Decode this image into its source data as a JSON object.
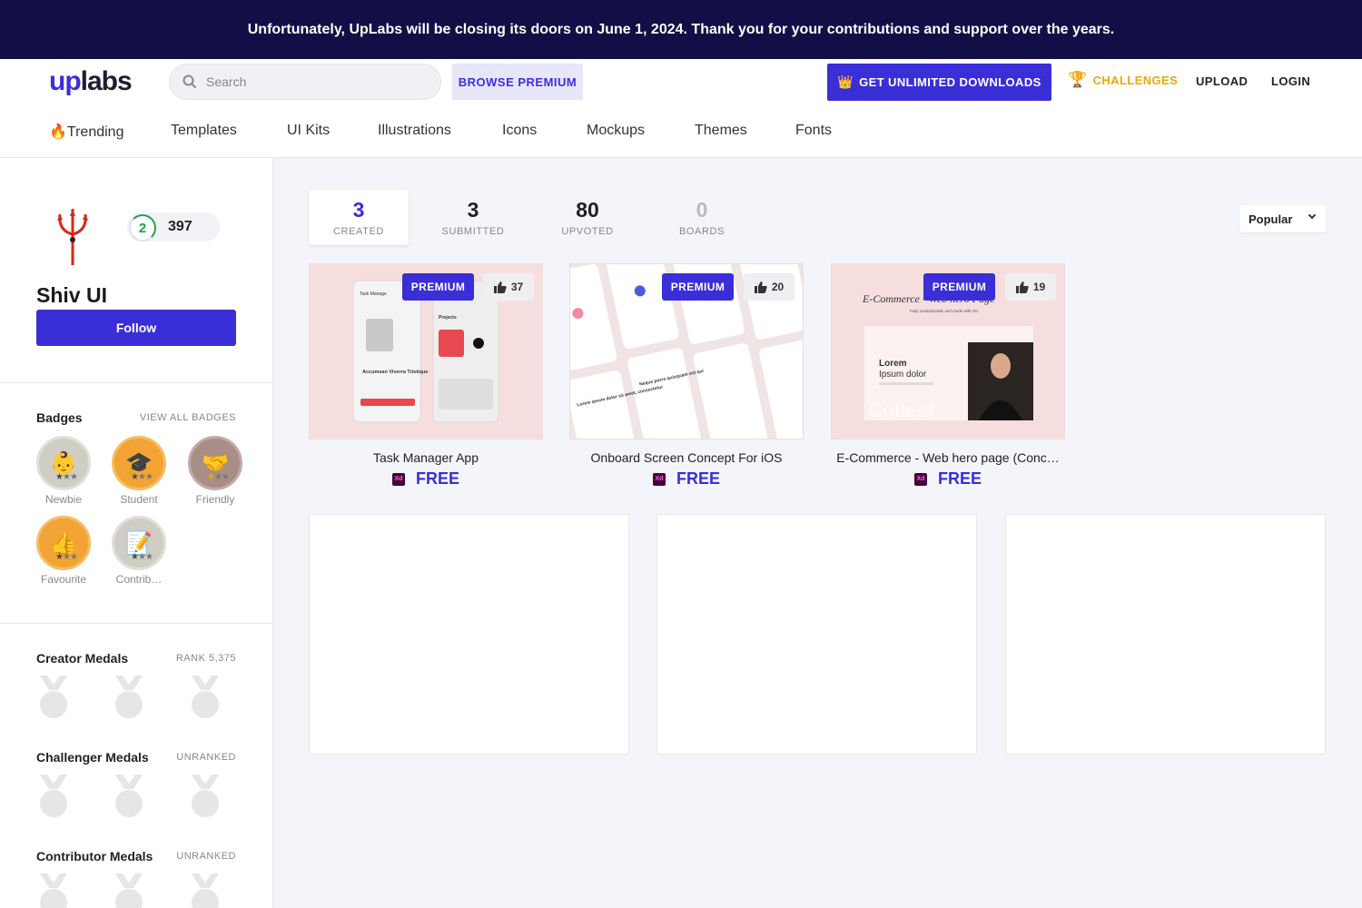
{
  "banner": {
    "text": "Unfortunately, UpLabs will be closing its doors on June 1, 2024. Thank you for your contributions and support over the years."
  },
  "header": {
    "logo_up": "up",
    "logo_labs": "labs",
    "search_placeholder": "Search",
    "browse_premium": "BROWSE PREMIUM",
    "get_unlimited": "GET UNLIMITED DOWNLOADS",
    "challenges": "CHALLENGES",
    "upload": "UPLOAD",
    "login": "LOGIN"
  },
  "categories": [
    {
      "label": "🔥Trending"
    },
    {
      "label": "Templates"
    },
    {
      "label": "UI Kits"
    },
    {
      "label": "Illustrations"
    },
    {
      "label": "Icons"
    },
    {
      "label": "Mockups"
    },
    {
      "label": "Themes"
    },
    {
      "label": "Fonts"
    }
  ],
  "profile": {
    "name": "Shiv UI",
    "level": "2",
    "points": "397",
    "follow_label": "Follow"
  },
  "badges": {
    "title": "Badges",
    "view_all": "VIEW ALL BADGES",
    "items": [
      {
        "label": "Newbie",
        "icon": "baby-icon",
        "glyph": "👶"
      },
      {
        "label": "Student",
        "icon": "graduation-cap-icon",
        "glyph": "🎓"
      },
      {
        "label": "Friendly",
        "icon": "handshake-icon",
        "glyph": "🤝"
      },
      {
        "label": "Favourite",
        "icon": "thumbs-up-icon",
        "glyph": "👍"
      },
      {
        "label": "Contrib…",
        "icon": "memo-icon",
        "glyph": "📝"
      }
    ]
  },
  "medals": {
    "creator": {
      "title": "Creator Medals",
      "rank": "RANK 5,375"
    },
    "challenger": {
      "title": "Challenger Medals",
      "rank": "UNRANKED"
    },
    "contributor": {
      "title": "Contributor Medals",
      "rank": "UNRANKED"
    }
  },
  "stats_tabs": [
    {
      "num": "3",
      "label": "CREATED"
    },
    {
      "num": "3",
      "label": "SUBMITTED"
    },
    {
      "num": "80",
      "label": "UPVOTED"
    },
    {
      "num": "0",
      "label": "BOARDS"
    }
  ],
  "sort": {
    "selected": "Popular"
  },
  "cards": [
    {
      "title": "Task Manager App",
      "premium": "PREMIUM",
      "likes": "37",
      "price": "FREE",
      "tool": "Xd"
    },
    {
      "title": "Onboard Screen Concept For iOS",
      "premium": "PREMIUM",
      "likes": "20",
      "price": "FREE",
      "tool": "Xd"
    },
    {
      "title": "E-Commerce - Web hero page (Conc…",
      "premium": "PREMIUM",
      "likes": "19",
      "price": "FREE",
      "tool": "Xd"
    }
  ],
  "card_mockups": {
    "task": {
      "heading": "Task Manage",
      "accumsan": "Accumsan Viverra Tristique",
      "projects": "Projects"
    },
    "ecommerce": {
      "heading": "E-Commerce - Web hero Page",
      "subheading": "Fully customizable and made with XD.",
      "lorem": "Lorem",
      "ipsum": "Ipsum dolor",
      "watermark": "Collect"
    },
    "onboard": {
      "line1": "Lorem ipsum dolor sit amet, consectetur",
      "line2": "Neque porro quisquam est qui"
    }
  },
  "colors": {
    "brand": "#3a2ed6",
    "banner_bg": "#140e47",
    "challenge_gold": "#e8a90c",
    "level_green": "#22a34b",
    "thumb_pink": "#f7dede"
  }
}
